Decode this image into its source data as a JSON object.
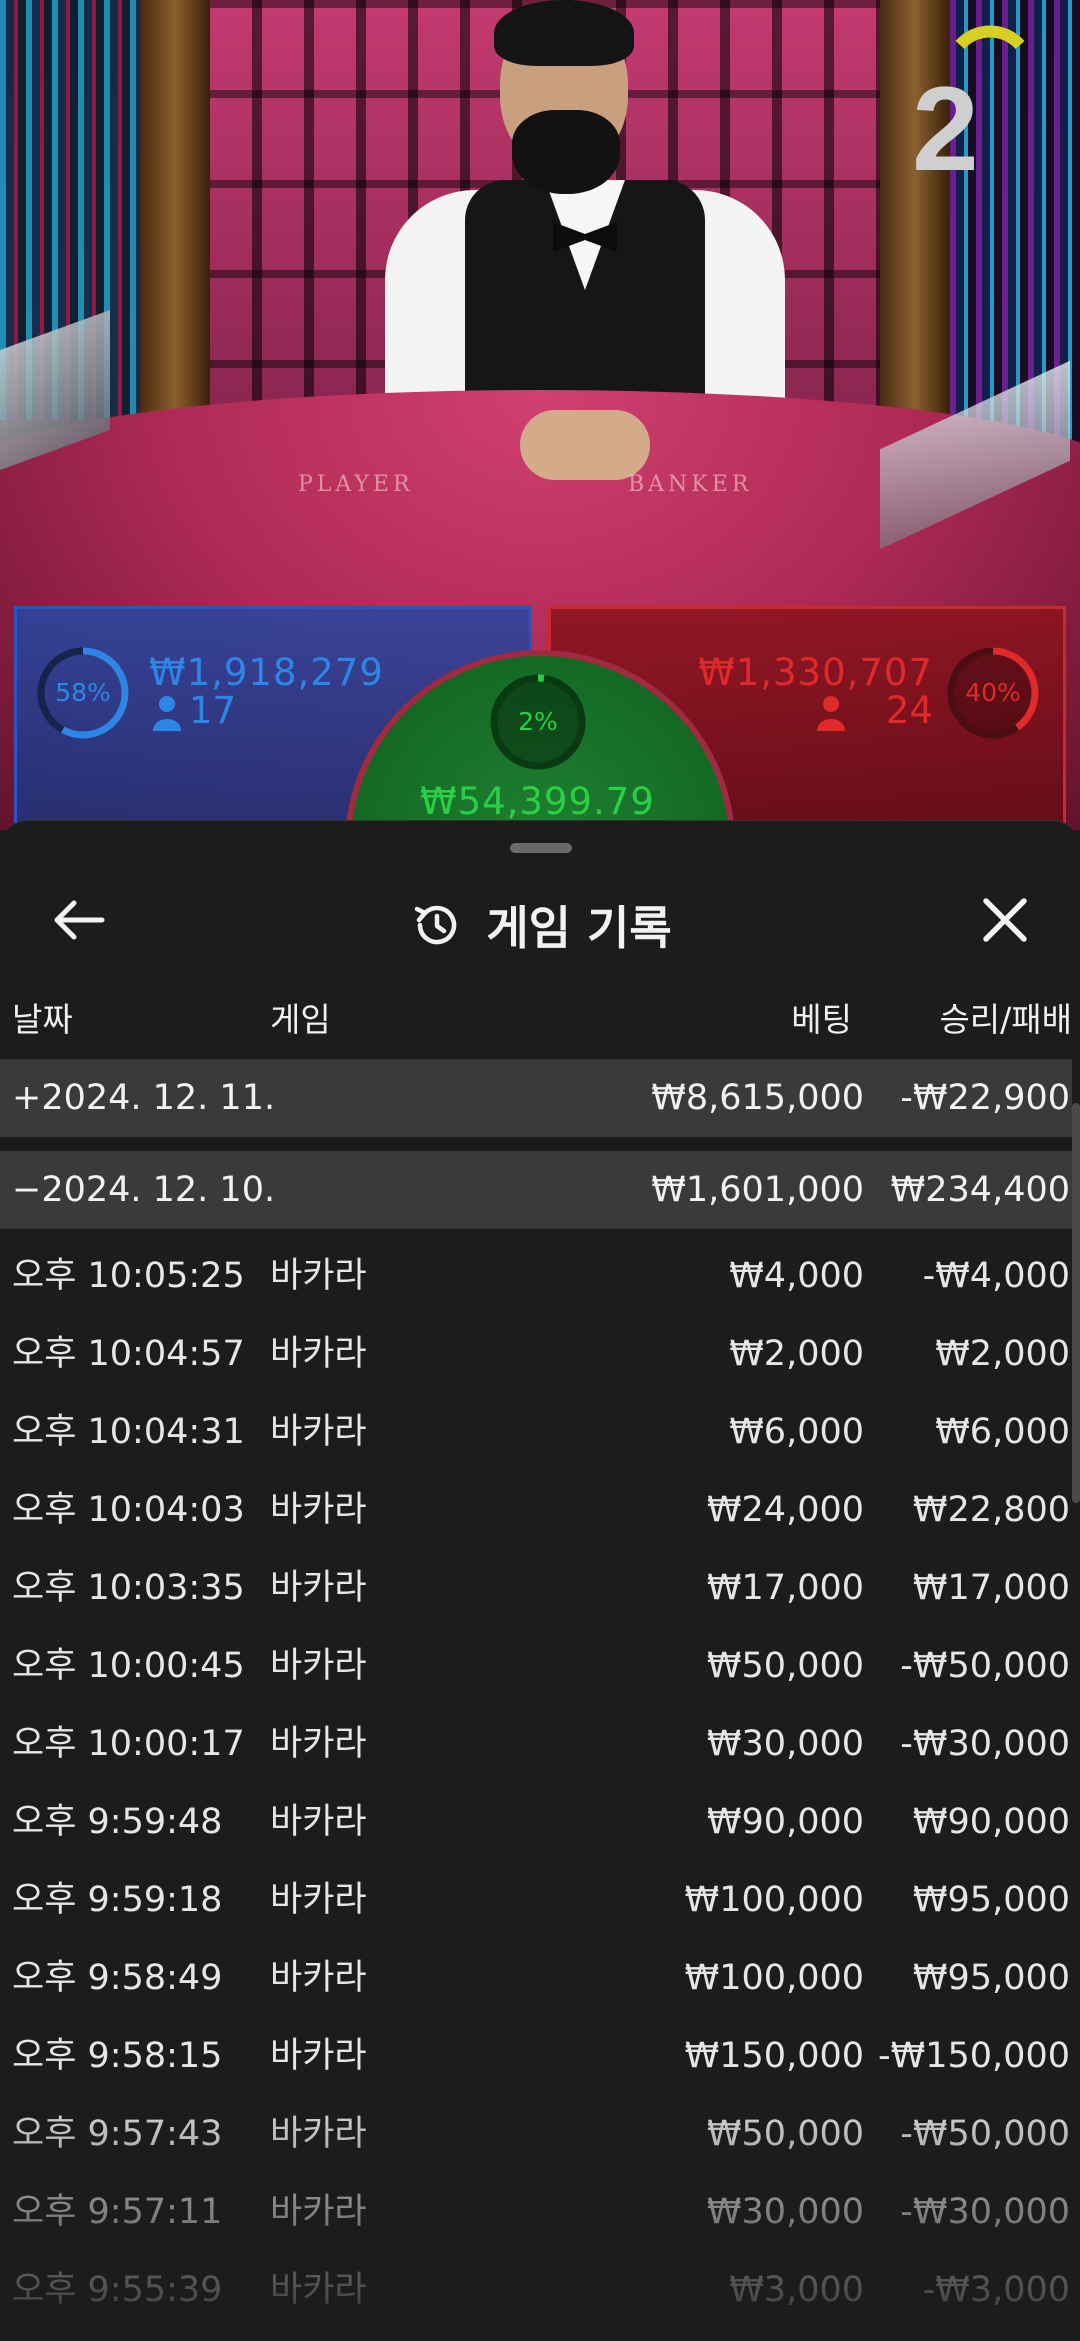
{
  "video": {
    "countdown": "2"
  },
  "player_panel": {
    "percent": "58%",
    "amount": "₩1,918,279",
    "players": "17",
    "color": "#2d86e6"
  },
  "banker_panel": {
    "percent": "40%",
    "amount": "₩1,330,707",
    "players": "24",
    "color": "#e02a2a"
  },
  "tie_panel": {
    "percent": "2%",
    "amount": "₩54,399.79",
    "color": "#29d046"
  },
  "table_labels": {
    "player": "PLAYER",
    "banker": "BANKER"
  },
  "sheet": {
    "title": "게임 기록",
    "back_icon": "arrow-left-icon",
    "history_icon": "history-icon",
    "close_icon": "close-icon",
    "columns": {
      "date": "날짜",
      "game": "게임",
      "bet": "베팅",
      "win_loss": "승리/패배"
    },
    "groups": [
      {
        "date": "+2024. 12. 11.",
        "bet": "₩8,615,000",
        "result": "-₩22,900"
      },
      {
        "date": "−2024. 12. 10.",
        "bet": "₩1,601,000",
        "result": "₩234,400"
      }
    ],
    "rows": [
      {
        "time": "오후 10:05:25",
        "game": "바카라",
        "bet": "₩4,000",
        "result": "-₩4,000"
      },
      {
        "time": "오후 10:04:57",
        "game": "바카라",
        "bet": "₩2,000",
        "result": "₩2,000"
      },
      {
        "time": "오후 10:04:31",
        "game": "바카라",
        "bet": "₩6,000",
        "result": "₩6,000"
      },
      {
        "time": "오후 10:04:03",
        "game": "바카라",
        "bet": "₩24,000",
        "result": "₩22,800"
      },
      {
        "time": "오후 10:03:35",
        "game": "바카라",
        "bet": "₩17,000",
        "result": "₩17,000"
      },
      {
        "time": "오후 10:00:45",
        "game": "바카라",
        "bet": "₩50,000",
        "result": "-₩50,000"
      },
      {
        "time": "오후 10:00:17",
        "game": "바카라",
        "bet": "₩30,000",
        "result": "-₩30,000"
      },
      {
        "time": "오후 9:59:48",
        "game": "바카라",
        "bet": "₩90,000",
        "result": "₩90,000"
      },
      {
        "time": "오후 9:59:18",
        "game": "바카라",
        "bet": "₩100,000",
        "result": "₩95,000"
      },
      {
        "time": "오후 9:58:49",
        "game": "바카라",
        "bet": "₩100,000",
        "result": "₩95,000"
      },
      {
        "time": "오후 9:58:15",
        "game": "바카라",
        "bet": "₩150,000",
        "result": "-₩150,000"
      },
      {
        "time": "오후 9:57:43",
        "game": "바카라",
        "bet": "₩50,000",
        "result": "-₩50,000"
      },
      {
        "time": "오후 9:57:11",
        "game": "바카라",
        "bet": "₩30,000",
        "result": "-₩30,000"
      },
      {
        "time": "오후 9:55:39",
        "game": "바카라",
        "bet": "₩3,000",
        "result": "-₩3,000"
      }
    ]
  }
}
